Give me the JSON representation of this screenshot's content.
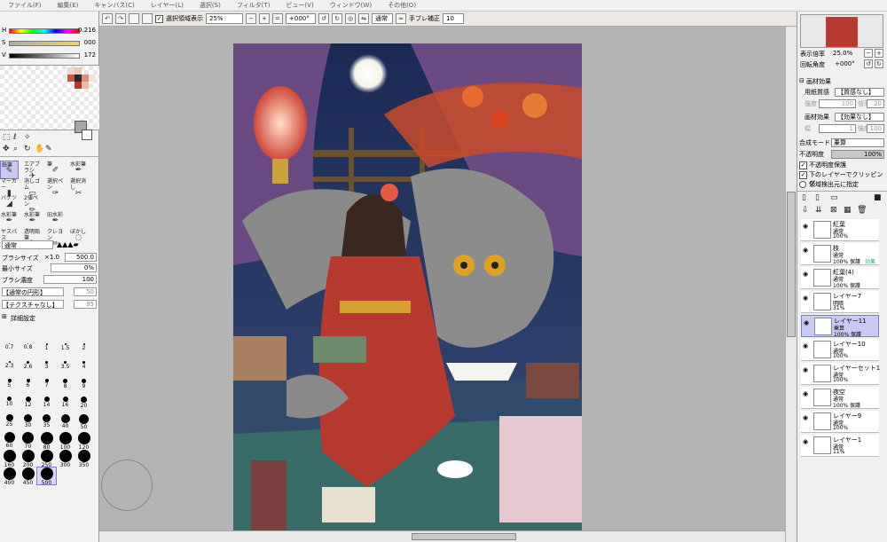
{
  "menubar": {
    "items": [
      "ファイル(F)",
      "編集(E)",
      "キャンバス(C)",
      "レイヤー(L)",
      "選択(S)",
      "フィルタ(T)",
      "ビュー(V)",
      "ウィンドウ(W)",
      "その他(O)"
    ]
  },
  "toolbar": {
    "selection_display_label": "選択領域表示",
    "zoom_value": "25%",
    "rotation_value": "+000°",
    "blend_mode": "通常",
    "stabilizer_label": "手ブレ補正",
    "stabilizer_value": "10"
  },
  "color_sliders": {
    "h_label": "H",
    "h_value": "0.216",
    "s_label": "S",
    "s_value": "000",
    "v_label": "V",
    "v_value": "172"
  },
  "brush_tools": [
    {
      "label": "鉛筆",
      "icon": "pencil-icon",
      "selected": true
    },
    {
      "label": "エアブラシ",
      "icon": "airbrush-icon",
      "selected": false
    },
    {
      "label": "筆",
      "icon": "brush-icon",
      "selected": false
    },
    {
      "label": "水彩筆",
      "icon": "watercolor-icon",
      "selected": false
    },
    {
      "label": "マーカー",
      "icon": "marker-icon",
      "selected": false
    },
    {
      "label": "消しゴム",
      "icon": "eraser-icon",
      "selected": false
    },
    {
      "label": "選択ペン",
      "icon": "select-pen-icon",
      "selected": false
    },
    {
      "label": "選択消し",
      "icon": "select-erase-icon",
      "selected": false
    },
    {
      "label": "バケツ",
      "icon": "bucket-icon",
      "selected": false
    },
    {
      "label": "2値ペン",
      "icon": "binary-pen-icon",
      "selected": false
    },
    {
      "label": "",
      "icon": "",
      "selected": false
    },
    {
      "label": "",
      "icon": "",
      "selected": false
    },
    {
      "label": "水彩筆",
      "icon": "watercolor-icon",
      "selected": false
    },
    {
      "label": "水彩筆",
      "icon": "watercolor-icon",
      "selected": false
    },
    {
      "label": "旧水彩",
      "icon": "old-watercolor-icon",
      "selected": false
    },
    {
      "label": "",
      "icon": "",
      "selected": false
    },
    {
      "label": "ヤスパス",
      "icon": "blur-icon",
      "selected": false
    },
    {
      "label": "透明鉛筆",
      "icon": "pencil-icon",
      "selected": false
    },
    {
      "label": "クレヨン",
      "icon": "crayon-icon",
      "selected": false
    },
    {
      "label": "ぼかし",
      "icon": "blur-icon",
      "selected": false
    }
  ],
  "brush_props": {
    "mode": "通常",
    "size_label": "ブラシサイズ",
    "size_mult": "×1.0",
    "size_value": "500.0",
    "min_size_label": "最小サイズ",
    "min_size_value": "0%",
    "density_label": "ブラシ濃度",
    "density_value": "100",
    "shape": "【通常の円形】",
    "shape_value": "50",
    "texture": "【テクスチャなし】",
    "texture_value": "95",
    "detail_label": "詳細設定"
  },
  "brush_sizes": [
    "0.7",
    "0.8",
    "1",
    "1.5",
    "2",
    "2.3",
    "2.6",
    "3",
    "3.5",
    "4",
    "5",
    "6",
    "7",
    "8",
    "9",
    "10",
    "12",
    "14",
    "16",
    "20",
    "25",
    "30",
    "35",
    "40",
    "50",
    "60",
    "70",
    "80",
    "100",
    "120",
    "160",
    "200",
    "250",
    "300",
    "350",
    "400",
    "450",
    "500"
  ],
  "navigator": {
    "zoom_label": "表示倍率",
    "zoom_value": "25.0%",
    "rotate_label": "回転角度",
    "rotate_value": "+000°"
  },
  "canvas_effects": {
    "section_label": "画材効果",
    "paper_label": "用紙質感",
    "paper_value": "【質感なし】",
    "strength_label": "強度",
    "strength_value": "100",
    "scale_label": "倍率",
    "scale_value": "20",
    "effect_label": "画材効果",
    "effect_value": "【効果なし】",
    "width_label": "幅",
    "width_value": "1",
    "effect_strength_label": "強度",
    "effect_strength_value": "100"
  },
  "layer_props": {
    "blend_label": "合成モード",
    "blend_value": "乗算",
    "opacity_label": "不透明度",
    "opacity_value": "100%",
    "preserve_label": "不透明度保護",
    "clip_label": "下のレイヤーでクリッピング",
    "source_label": "領域検出元に指定"
  },
  "layers": [
    {
      "name": "紅葉",
      "mode": "通常",
      "opacity": "100%",
      "extra": "",
      "selected": false
    },
    {
      "name": "枝",
      "mode": "通常",
      "opacity": "100% 保護",
      "extra": "効果",
      "selected": false
    },
    {
      "name": "紅葉(4)",
      "mode": "通常",
      "opacity": "100% 保護",
      "extra": "",
      "selected": false
    },
    {
      "name": "レイヤー7",
      "mode": "明暗",
      "opacity": "31%",
      "extra": "",
      "selected": false
    },
    {
      "name": "レイヤー11",
      "mode": "乗算",
      "opacity": "100% 保護",
      "extra": "",
      "selected": true
    },
    {
      "name": "レイヤー10",
      "mode": "通常",
      "opacity": "100%",
      "extra": "",
      "selected": false
    },
    {
      "name": "レイヤーセット1",
      "mode": "通常",
      "opacity": "100%",
      "extra": "",
      "selected": false
    },
    {
      "name": "夜空",
      "mode": "通常",
      "opacity": "100% 保護",
      "extra": "",
      "selected": false
    },
    {
      "name": "レイヤー9",
      "mode": "通常",
      "opacity": "100%",
      "extra": "",
      "selected": false
    },
    {
      "name": "レイヤー1",
      "mode": "通常",
      "opacity": "11%",
      "extra": "",
      "selected": false
    }
  ],
  "colors": {
    "selection_accent": "#7a7ad8",
    "canvas_bg": "#b4b4b4"
  }
}
